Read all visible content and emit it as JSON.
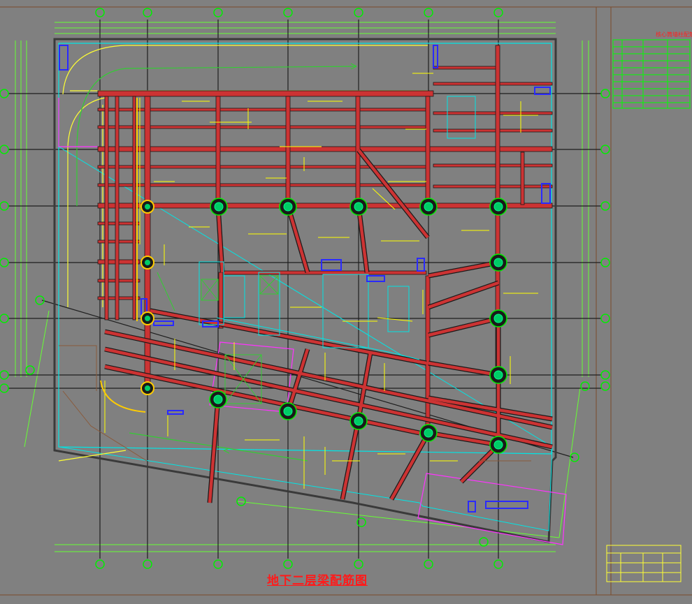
{
  "drawing": {
    "title": "地下二层梁配筋图",
    "title_block_caption": "核心筒墙柱配筋表"
  },
  "colors": {
    "background": "#808080",
    "grid_lines": "#1f1f1f",
    "axis_bubbles": "#00ee00",
    "dimension_lines": "#66ff33",
    "beams": "#cc3333",
    "beam_edges": "#1a1a1a",
    "slab_outline": "#00e5e5",
    "rebar_annotations": "#ffff00",
    "openings": "#2a2aff",
    "ramp_outline": "#ff33ff",
    "title": "#ff1a1a",
    "table_lines": "#00ff00",
    "title_block_lines": "#ffff00"
  },
  "icons": {
    "axis_bubble": "circle-axis-marker",
    "column": "circle-column-marker",
    "arrow": "direction-arrow"
  }
}
